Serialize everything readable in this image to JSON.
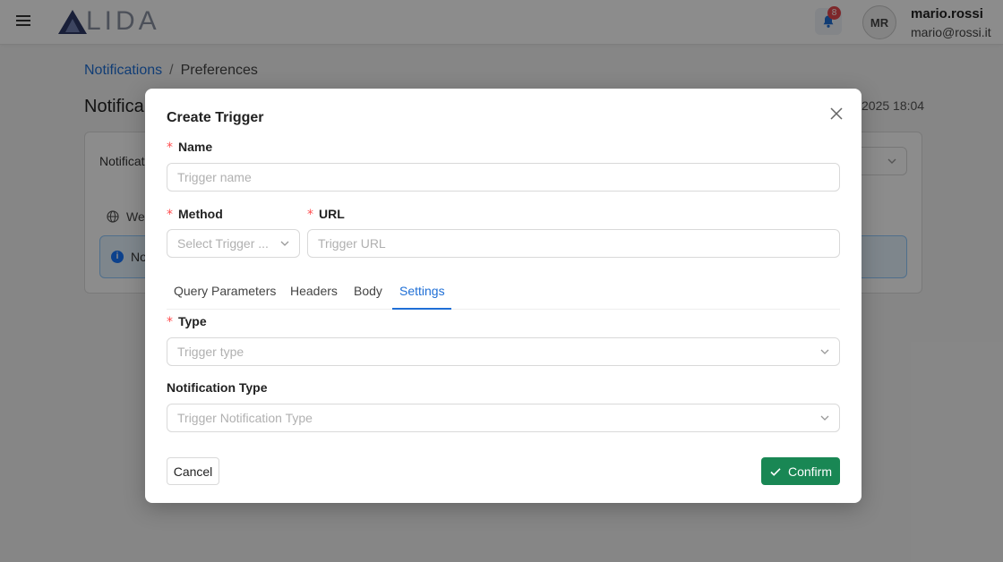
{
  "header": {
    "logo_text": "LIDA",
    "notifications_count": "8",
    "avatar_initials": "MR",
    "user_name": "mario.rossi",
    "user_email": "mario@rossi.it"
  },
  "breadcrumb": {
    "link": "Notifications",
    "separator": "/",
    "current": "Preferences"
  },
  "page": {
    "title": "Notifica",
    "date": "2025 18:04",
    "card_label": "Notificat",
    "web_label": "We",
    "info_text": "No"
  },
  "modal": {
    "title": "Create Trigger",
    "required_mark": "*",
    "name_label": "Name",
    "name_placeholder": "Trigger name",
    "method_label": "Method",
    "method_placeholder": "Select Trigger ...",
    "url_label": "URL",
    "url_placeholder": "Trigger URL",
    "tabs": [
      {
        "label": "Query Parameters",
        "active": false
      },
      {
        "label": "Headers",
        "active": false
      },
      {
        "label": "Body",
        "active": false
      },
      {
        "label": "Settings",
        "active": true
      }
    ],
    "type_label": "Type",
    "type_placeholder": "Trigger type",
    "notification_type_label": "Notification Type",
    "notification_type_placeholder": "Trigger Notification Type",
    "cancel_label": "Cancel",
    "confirm_label": "Confirm"
  },
  "colors": {
    "link": "#1f6fd6",
    "confirm": "#198754",
    "required": "#ff4d4f",
    "badge": "#e5484d"
  }
}
